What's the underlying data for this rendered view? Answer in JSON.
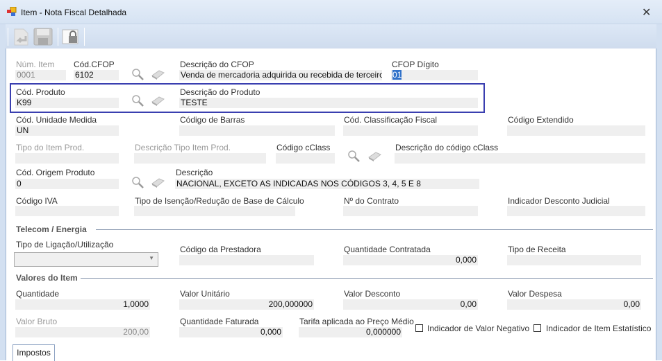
{
  "window": {
    "title": "Item - Nota Fiscal Detalhada",
    "close": "✕"
  },
  "toolbar": {
    "buttons": [
      "undo-document",
      "save",
      "lock"
    ]
  },
  "fields": {
    "num_item": {
      "label": "Núm. Item",
      "value": "0001"
    },
    "cod_cfop": {
      "label": "Cód.CFOP",
      "value": "6102"
    },
    "desc_cfop": {
      "label": "Descrição do CFOP",
      "value": "Venda de mercadoria adquirida ou recebida de terceiros"
    },
    "cfop_digito": {
      "label": "CFOP Dígito",
      "value": "01"
    },
    "cod_produto": {
      "label": "Cód. Produto",
      "value": "K99"
    },
    "desc_produto": {
      "label": "Descrição do Produto",
      "value": "TESTE"
    },
    "cod_unidade": {
      "label": "Cód. Unidade Medida",
      "value": "UN"
    },
    "cod_barras": {
      "label": "Código de Barras",
      "value": ""
    },
    "cod_class_fiscal": {
      "label": "Cód. Classificação Fiscal",
      "value": ""
    },
    "cod_extendido": {
      "label": "Código Extendido",
      "value": ""
    },
    "tipo_item": {
      "label": "Tipo do Item Prod.",
      "value": ""
    },
    "desc_tipo_item": {
      "label": "Descrição Tipo Item Prod.",
      "value": ""
    },
    "cod_cclass": {
      "label": "Código cClass",
      "value": ""
    },
    "desc_cclass": {
      "label": "Descrição do código cClass",
      "value": ""
    },
    "cod_origem": {
      "label": "Cód. Origem Produto",
      "value": "0"
    },
    "desc_origem": {
      "label": "Descrição",
      "value": "NACIONAL, EXCETO AS INDICADAS NOS CÓDIGOS 3, 4, 5 E 8"
    },
    "cod_iva": {
      "label": "Código IVA",
      "value": ""
    },
    "tipo_isencao": {
      "label": "Tipo de Isenção/Redução de Base de Cálculo",
      "value": ""
    },
    "num_contrato": {
      "label": "Nº do Contrato",
      "value": ""
    },
    "ind_desc_judicial": {
      "label": "Indicador Desconto Judicial",
      "value": ""
    },
    "tipo_ligacao": {
      "label": "Tipo de Ligação/Utilização",
      "value": ""
    },
    "cod_prestadora": {
      "label": "Código da Prestadora",
      "value": ""
    },
    "qtd_contratada": {
      "label": "Quantidade Contratada",
      "value": "0,000"
    },
    "tipo_receita": {
      "label": "Tipo de Receita",
      "value": ""
    },
    "quantidade": {
      "label": "Quantidade",
      "value": "1,0000"
    },
    "valor_unitario": {
      "label": "Valor Unitário",
      "value": "200,000000"
    },
    "valor_desconto": {
      "label": "Valor Desconto",
      "value": "0,00"
    },
    "valor_despesa": {
      "label": "Valor Despesa",
      "value": "0,00"
    },
    "valor_bruto": {
      "label": "Valor Bruto",
      "value": "200,00"
    },
    "qtd_faturada": {
      "label": "Quantidade Faturada",
      "value": "0,000"
    },
    "tarifa": {
      "label": "Tarifa aplicada ao Preço Médio",
      "value": "0,000000"
    }
  },
  "sections": {
    "telecom": "Telecom / Energia",
    "valores": "Valores do Item"
  },
  "checkboxes": {
    "valor_negativo": {
      "label": "Indicador de Valor Negativo",
      "checked": false
    },
    "item_estatistico": {
      "label": "Indicador de Item Estatístico",
      "checked": false
    }
  },
  "tabs": {
    "impostos": "Impostos"
  }
}
